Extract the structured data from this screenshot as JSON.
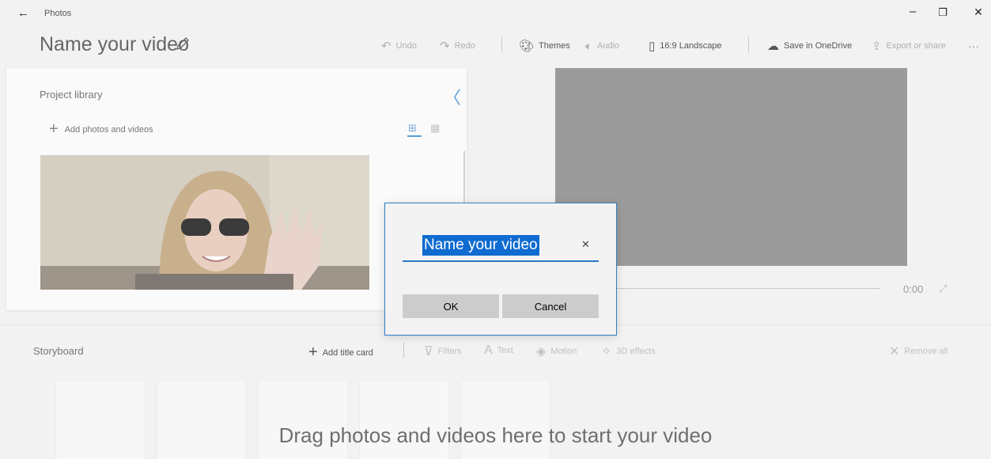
{
  "window": {
    "app_name": "Photos",
    "back_glyph": "←",
    "minimize_glyph": "–",
    "restore_glyph": "❐",
    "close_glyph": "✕"
  },
  "project": {
    "name": "Name your video"
  },
  "toolbar": {
    "undo": "Undo",
    "redo": "Redo",
    "themes": "Themes",
    "audio": "Audio",
    "aspect": "16:9 Landscape",
    "save_onedrive": "Save in OneDrive",
    "export_share": "Export or share",
    "more": "···"
  },
  "library": {
    "title": "Project library",
    "add_media": "Add photos and videos",
    "collapse_glyph": "〈"
  },
  "preview": {
    "time": "0:00"
  },
  "storyboard": {
    "title": "Storyboard",
    "add_title_card": "Add title card",
    "filters": "Filters",
    "text": "Text",
    "motion": "Motion",
    "effects_3d": "3D effects",
    "remove_all": "Remove all",
    "drop_hint": "Drag photos and videos here to start your video"
  },
  "dialog": {
    "input_value": "Name your video",
    "clear_glyph": "✕",
    "ok_label": "OK",
    "cancel_label": "Cancel"
  },
  "colors": {
    "accent": "#2a77c9",
    "selection": "#0f6bd0",
    "preview_bg": "#9b9b9b"
  }
}
